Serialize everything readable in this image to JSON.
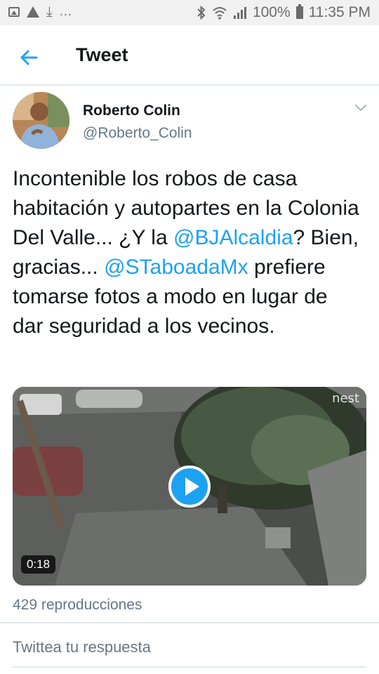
{
  "status_bar": {
    "left_icons": [
      "image-icon",
      "warning-icon",
      "download-icon"
    ],
    "overflow": "...",
    "right_icons": [
      "bluetooth-icon",
      "wifi-icon",
      "signal-icon",
      "battery-icon"
    ],
    "battery": "100%",
    "time": "11:35 PM"
  },
  "header": {
    "back_icon": "arrow-left-icon",
    "title": "Tweet"
  },
  "tweet": {
    "author_name": "Roberto Colin",
    "author_handle": "@Roberto_Colin",
    "menu_icon": "chevron-down-icon",
    "text": {
      "part1": "Incontenible los robos de casa habitación y autopartes en la Colonia Del Valle... ¿Y la ",
      "mention1": "@BJAlcaldia",
      "part2": "? Bien, gracias... ",
      "mention2": "@STaboadaMx",
      "part3": " prefiere tomarse fotos a modo en lugar de dar seguridad a los vecinos."
    },
    "video": {
      "duration": "0:18",
      "watermark": "nest",
      "play_icon": "play-icon"
    },
    "views": "429 reproducciones"
  },
  "reply": {
    "placeholder": "Twittea tu respuesta"
  },
  "colors": {
    "accent": "#1da1f2",
    "secondary_text": "#657786",
    "divider": "#e1e8ed"
  }
}
